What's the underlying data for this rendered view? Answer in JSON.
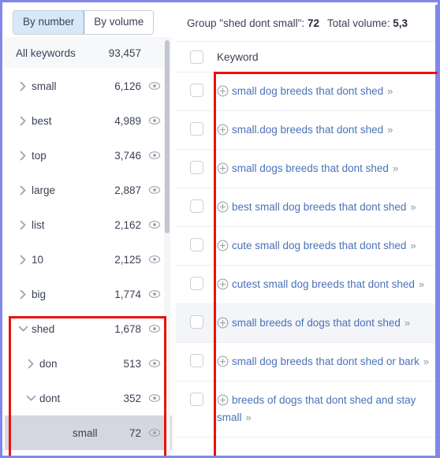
{
  "left_panel": {
    "toggle": {
      "options": [
        {
          "label": "By number",
          "active": true
        },
        {
          "label": "By volume",
          "active": false
        }
      ]
    },
    "all_keywords": {
      "label": "All keywords",
      "count": "93,457"
    },
    "tree": [
      {
        "label": "small",
        "count": "6,126",
        "chevron": "right",
        "level": 0,
        "selected": false,
        "eye": true
      },
      {
        "label": "best",
        "count": "4,989",
        "chevron": "right",
        "level": 0,
        "selected": false,
        "eye": true
      },
      {
        "label": "top",
        "count": "3,746",
        "chevron": "right",
        "level": 0,
        "selected": false,
        "eye": true
      },
      {
        "label": "large",
        "count": "2,887",
        "chevron": "right",
        "level": 0,
        "selected": false,
        "eye": true
      },
      {
        "label": "list",
        "count": "2,162",
        "chevron": "right",
        "level": 0,
        "selected": false,
        "eye": true
      },
      {
        "label": "10",
        "count": "2,125",
        "chevron": "right",
        "level": 0,
        "selected": false,
        "eye": true
      },
      {
        "label": "big",
        "count": "1,774",
        "chevron": "right",
        "level": 0,
        "selected": false,
        "eye": true
      },
      {
        "label": "shed",
        "count": "1,678",
        "chevron": "down",
        "level": 0,
        "selected": false,
        "eye": true
      },
      {
        "label": "don",
        "count": "513",
        "chevron": "right",
        "level": 1,
        "selected": false,
        "eye": true
      },
      {
        "label": "dont",
        "count": "352",
        "chevron": "down",
        "level": 1,
        "selected": false,
        "eye": true
      },
      {
        "label": "small",
        "count": "72",
        "chevron": "none",
        "level": 3,
        "selected": true,
        "eye": true
      }
    ],
    "scrollbar": {
      "name": "vertical-scrollbar"
    }
  },
  "right_panel": {
    "header": {
      "group_prefix": "Group \"shed dont small\":",
      "group_count": "72",
      "volume_label": "Total volume:",
      "volume_value": "5,3"
    },
    "column_header": {
      "keyword": "Keyword"
    },
    "rows": [
      {
        "keyword": "small dog breeds that dont shed",
        "hover": false
      },
      {
        "keyword": "small.dog breeds that dont shed",
        "hover": false
      },
      {
        "keyword": "small dogs breeds that dont shed",
        "hover": false
      },
      {
        "keyword": "best small dog breeds that dont shed",
        "hover": false
      },
      {
        "keyword": "cute small dog breeds that dont shed",
        "hover": false
      },
      {
        "keyword": "cutest small dog breeds that dont shed",
        "hover": false
      },
      {
        "keyword": "small breeds of dogs that dont shed",
        "hover": true
      },
      {
        "keyword": "small dog breeds that dont shed or bark",
        "hover": false
      },
      {
        "keyword": "breeds of dogs that dont shed and stay small",
        "hover": false
      }
    ]
  },
  "annotations": {
    "tree_highlight": "red-box-around-shed-subtree",
    "keyword_highlight": "red-box-around-keyword-list"
  },
  "colors": {
    "frame": "#8186e8",
    "annotation": "#e8130d",
    "link": "#4a72b8",
    "active_tab_bg": "#d7e9f8",
    "selected_row_bg": "#d5d7e0"
  }
}
